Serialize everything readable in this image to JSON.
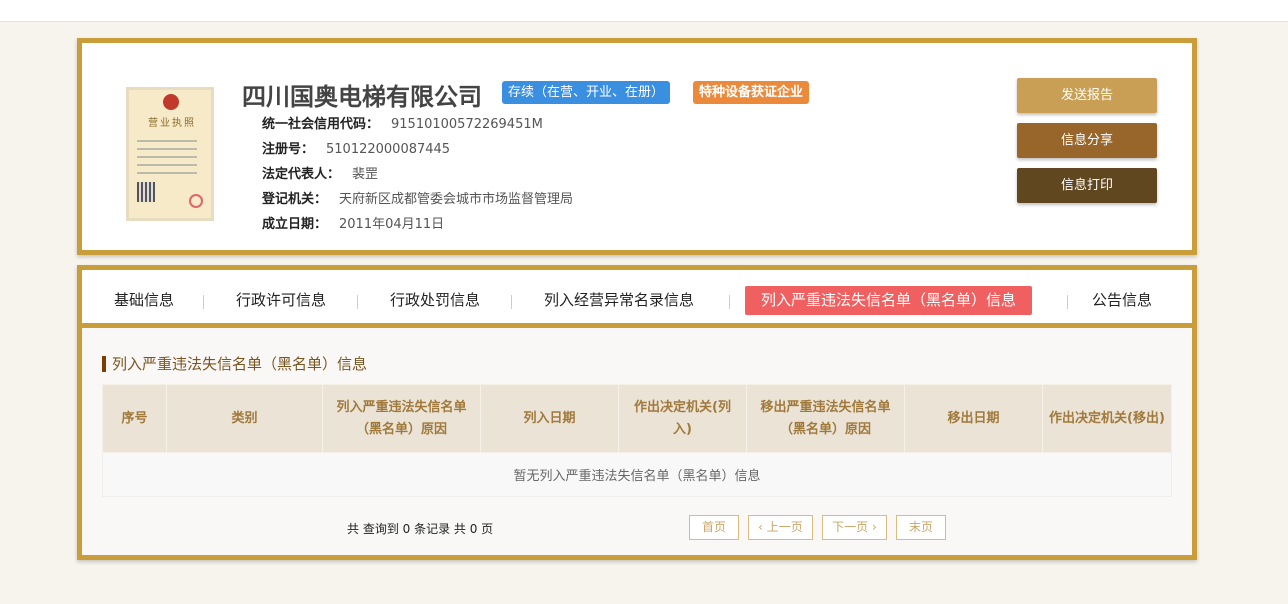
{
  "company": {
    "name": "四川国奥电梯有限公司",
    "status_badge": "存续（在营、开业、在册）",
    "tag_badge": "特种设备获证企业",
    "license_image_text": "营业执照",
    "fields": [
      {
        "label": "统一社会信用代码：",
        "value": "91510100572269451M"
      },
      {
        "label": "注册号：",
        "value": "510122000087445"
      },
      {
        "label": "法定代表人：",
        "value": "裴罡"
      },
      {
        "label": "登记机关：",
        "value": "天府新区成都管委会城市市场监督管理局"
      },
      {
        "label": "成立日期：",
        "value": "2011年04月11日"
      }
    ]
  },
  "actions": {
    "send": "发送报告",
    "share": "信息分享",
    "print": "信息打印"
  },
  "tabs": [
    "基础信息",
    "行政许可信息",
    "行政处罚信息",
    "列入经营异常名录信息",
    "列入严重违法失信名单（黑名单）信息",
    "公告信息"
  ],
  "section": {
    "title": "列入严重违法失信名单（黑名单）信息",
    "columns": [
      "序号",
      "类别",
      "列入严重违法失信名单（黑名单）原因",
      "列入日期",
      "作出决定机关(列入)",
      "移出严重违法失信名单（黑名单）原因",
      "移出日期",
      "作出决定机关(移出)"
    ],
    "empty": "暂无列入严重违法失信名单（黑名单）信息"
  },
  "pagination": {
    "summary": "共 查询到 0 条记录 共 0 页",
    "first": "首页",
    "prev": "上一页",
    "next": "下一页",
    "last": "末页"
  }
}
